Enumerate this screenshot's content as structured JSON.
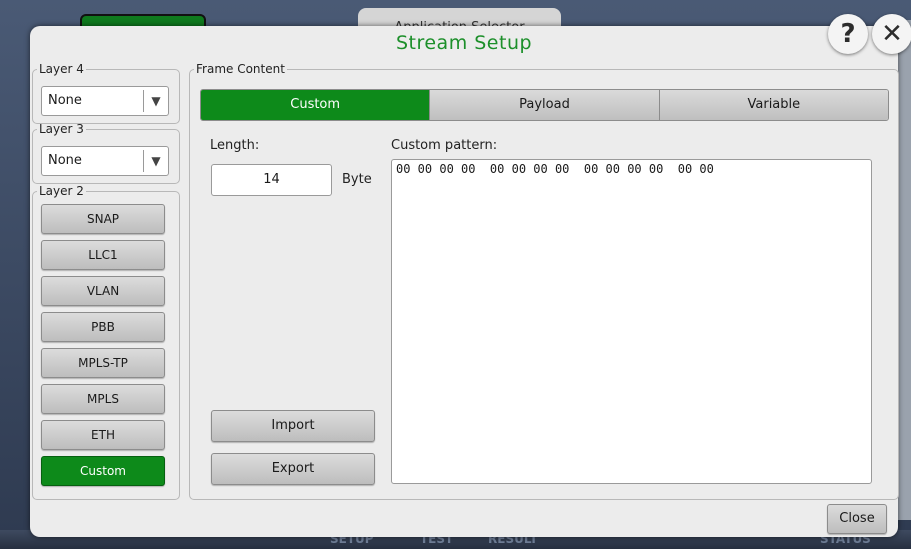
{
  "background": {
    "app_tab": "Application Selector",
    "taskbar": [
      "SETUP",
      "TEST",
      "RESULT",
      "STATUS"
    ]
  },
  "dialog": {
    "title": "Stream Setup",
    "help_label": "?",
    "close_x_label": "✕",
    "close_label": "Close"
  },
  "layer4": {
    "legend": "Layer 4",
    "value": "None"
  },
  "layer3": {
    "legend": "Layer 3",
    "value": "None"
  },
  "layer2": {
    "legend": "Layer 2",
    "buttons": [
      "SNAP",
      "LLC1",
      "VLAN",
      "PBB",
      "MPLS-TP",
      "MPLS",
      "ETH",
      "Custom"
    ],
    "active": "Custom"
  },
  "frame_content": {
    "legend": "Frame Content",
    "tabs": [
      "Custom",
      "Payload",
      "Variable"
    ],
    "active_tab": "Custom",
    "length_label": "Length:",
    "length_value": "14",
    "length_unit": "Byte",
    "pattern_label": "Custom pattern:",
    "pattern_value": "00 00 00 00  00 00 00 00  00 00 00 00  00 00",
    "import_label": "Import",
    "export_label": "Export"
  },
  "colors": {
    "accent_green": "#0d8a1a",
    "title_green": "#1c8f2a"
  }
}
